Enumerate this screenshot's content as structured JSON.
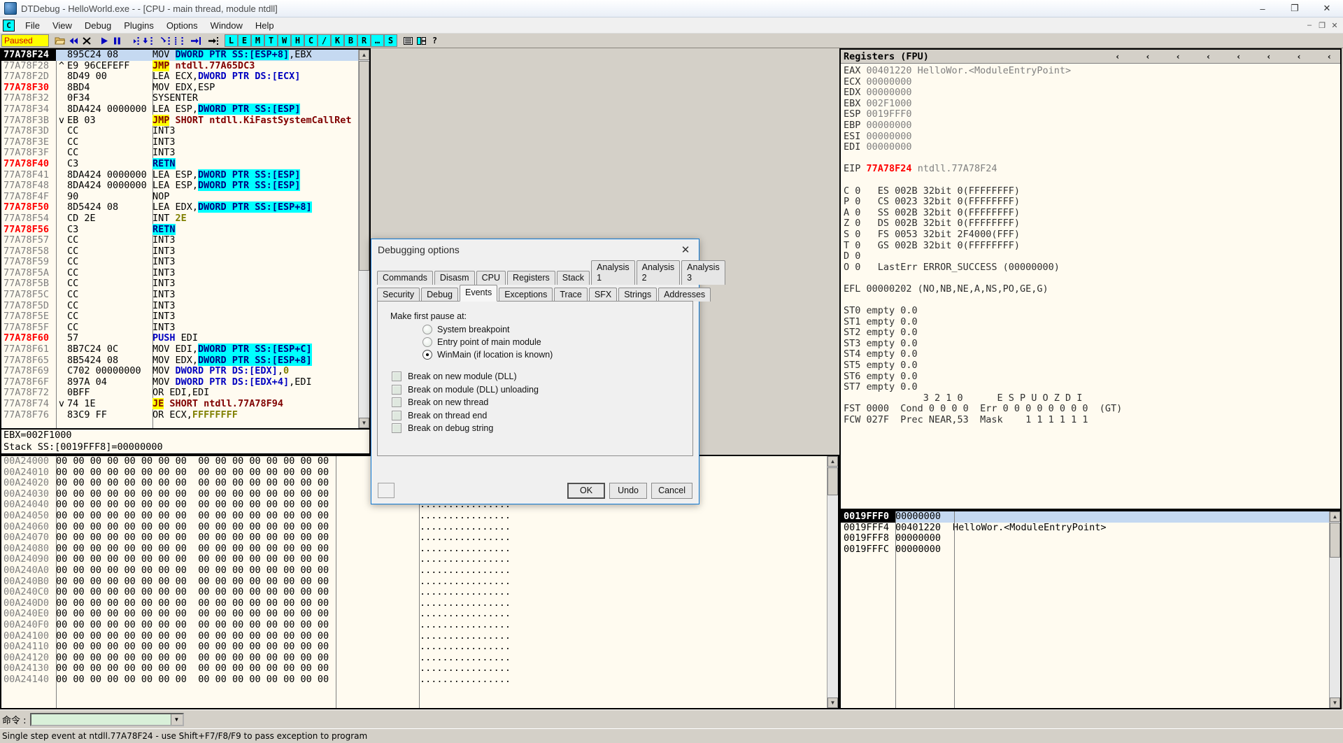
{
  "window": {
    "title": "DTDebug - HelloWorld.exe - - [CPU - main thread, module ntdll]",
    "app_icon": "debugger-icon",
    "minimize": "–",
    "maximize": "❐",
    "close": "✕"
  },
  "menu": {
    "mdi_icon_label": "C",
    "items": [
      "File",
      "View",
      "Debug",
      "Plugins",
      "Options",
      "Window",
      "Help"
    ],
    "sys_buttons": [
      "–",
      "❐",
      "✕"
    ]
  },
  "toolbar": {
    "status_label": "Paused",
    "buttons": [
      {
        "name": "open-file",
        "glyph": "icon-open"
      },
      {
        "name": "restart",
        "glyph": "icon-restart"
      },
      {
        "name": "close-program",
        "glyph": "icon-close-x"
      },
      {
        "name": "run",
        "glyph": "icon-run"
      },
      {
        "name": "pause",
        "glyph": "icon-pause"
      },
      {
        "name": "step-into",
        "glyph": "icon-step-into"
      },
      {
        "name": "step-over",
        "glyph": "icon-step-over"
      },
      {
        "name": "trace-into",
        "glyph": "icon-trace-into"
      },
      {
        "name": "trace-over",
        "glyph": "icon-trace-over"
      },
      {
        "name": "execute-till-return",
        "glyph": "icon-till-return"
      },
      {
        "name": "execute-till-cursor",
        "glyph": "icon-till-cursor"
      }
    ],
    "letters": [
      "L",
      "E",
      "M",
      "T",
      "W",
      "H",
      "C",
      "/",
      "K",
      "B",
      "R",
      "…",
      "S"
    ],
    "extra": [
      {
        "name": "options-window",
        "glyph": "icon-options"
      },
      {
        "name": "help",
        "glyph": "icon-help"
      },
      {
        "name": "question",
        "glyph": "?"
      }
    ]
  },
  "disassembly": {
    "panel_name": "CPU - main thread, module ntdll",
    "rows": [
      {
        "addr": "77A78F24",
        "hot": true,
        "selected": true,
        "arrow": "",
        "hex": "895C24 08",
        "parts": [
          {
            "t": "MOV ",
            "c": "plain"
          },
          {
            "t": "DWORD PTR SS:[ESP+8]",
            "c": "hl"
          },
          {
            "t": ",EBX",
            "c": "plain"
          }
        ]
      },
      {
        "addr": "77A78F28",
        "hot": false,
        "selected": false,
        "arrow": "^",
        "hex": "E9 96CEFEFF",
        "parts": [
          {
            "t": "JMP",
            "c": "jmp"
          },
          {
            "t": " ",
            "c": "plain"
          },
          {
            "t": "ntdll.77A65DC3",
            "c": "sym"
          }
        ]
      },
      {
        "addr": "77A78F2D",
        "hot": false,
        "selected": false,
        "arrow": "",
        "hex": "8D49 00",
        "parts": [
          {
            "t": "LEA ECX,",
            "c": "plain"
          },
          {
            "t": "DWORD PTR DS:[ECX]",
            "c": "kw"
          }
        ]
      },
      {
        "addr": "77A78F30",
        "hot": true,
        "selected": false,
        "arrow": "",
        "hex": "8BD4",
        "parts": [
          {
            "t": "MOV EDX,ESP",
            "c": "plain"
          }
        ]
      },
      {
        "addr": "77A78F32",
        "hot": false,
        "selected": false,
        "arrow": "",
        "hex": "0F34",
        "parts": [
          {
            "t": "SYSENTER",
            "c": "plain"
          }
        ]
      },
      {
        "addr": "77A78F34",
        "hot": false,
        "selected": false,
        "arrow": "",
        "hex": "8DA424 0000000",
        "parts": [
          {
            "t": "LEA ESP,",
            "c": "plain"
          },
          {
            "t": "DWORD PTR SS:[ESP]",
            "c": "hl"
          }
        ]
      },
      {
        "addr": "77A78F3B",
        "hot": false,
        "selected": false,
        "arrow": "v",
        "hex": "EB 03",
        "parts": [
          {
            "t": "JMP",
            "c": "jmp"
          },
          {
            "t": " ",
            "c": "plain"
          },
          {
            "t": "SHORT ntdll.KiFastSystemCallRet",
            "c": "sym"
          }
        ]
      },
      {
        "addr": "77A78F3D",
        "hot": false,
        "selected": false,
        "arrow": "",
        "hex": "CC",
        "parts": [
          {
            "t": "INT3",
            "c": "plain"
          }
        ]
      },
      {
        "addr": "77A78F3E",
        "hot": false,
        "selected": false,
        "arrow": "",
        "hex": "CC",
        "parts": [
          {
            "t": "INT3",
            "c": "plain"
          }
        ]
      },
      {
        "addr": "77A78F3F",
        "hot": false,
        "selected": false,
        "arrow": "",
        "hex": "CC",
        "parts": [
          {
            "t": "INT3",
            "c": "plain"
          }
        ]
      },
      {
        "addr": "77A78F40",
        "hot": true,
        "selected": false,
        "arrow": "",
        "hex": "C3",
        "parts": [
          {
            "t": "RETN",
            "c": "hl"
          }
        ]
      },
      {
        "addr": "77A78F41",
        "hot": false,
        "selected": false,
        "arrow": "",
        "hex": "8DA424 0000000",
        "parts": [
          {
            "t": "LEA ESP,",
            "c": "plain"
          },
          {
            "t": "DWORD PTR SS:[ESP]",
            "c": "hl"
          }
        ]
      },
      {
        "addr": "77A78F48",
        "hot": false,
        "selected": false,
        "arrow": "",
        "hex": "8DA424 0000000",
        "parts": [
          {
            "t": "LEA ESP,",
            "c": "plain"
          },
          {
            "t": "DWORD PTR SS:[ESP]",
            "c": "hl"
          }
        ]
      },
      {
        "addr": "77A78F4F",
        "hot": false,
        "selected": false,
        "arrow": "",
        "hex": "90",
        "parts": [
          {
            "t": "NOP",
            "c": "plain"
          }
        ]
      },
      {
        "addr": "77A78F50",
        "hot": true,
        "selected": false,
        "arrow": "",
        "hex": "8D5424 08",
        "parts": [
          {
            "t": "LEA EDX,",
            "c": "plain"
          },
          {
            "t": "DWORD PTR SS:[ESP+8]",
            "c": "hl"
          }
        ]
      },
      {
        "addr": "77A78F54",
        "hot": false,
        "selected": false,
        "arrow": "",
        "hex": "CD 2E",
        "parts": [
          {
            "t": "INT ",
            "c": "plain"
          },
          {
            "t": "2E",
            "c": "num"
          }
        ]
      },
      {
        "addr": "77A78F56",
        "hot": true,
        "selected": false,
        "arrow": "",
        "hex": "C3",
        "parts": [
          {
            "t": "RETN",
            "c": "hl"
          }
        ]
      },
      {
        "addr": "77A78F57",
        "hot": false,
        "selected": false,
        "arrow": "",
        "hex": "CC",
        "parts": [
          {
            "t": "INT3",
            "c": "plain"
          }
        ]
      },
      {
        "addr": "77A78F58",
        "hot": false,
        "selected": false,
        "arrow": "",
        "hex": "CC",
        "parts": [
          {
            "t": "INT3",
            "c": "plain"
          }
        ]
      },
      {
        "addr": "77A78F59",
        "hot": false,
        "selected": false,
        "arrow": "",
        "hex": "CC",
        "parts": [
          {
            "t": "INT3",
            "c": "plain"
          }
        ]
      },
      {
        "addr": "77A78F5A",
        "hot": false,
        "selected": false,
        "arrow": "",
        "hex": "CC",
        "parts": [
          {
            "t": "INT3",
            "c": "plain"
          }
        ]
      },
      {
        "addr": "77A78F5B",
        "hot": false,
        "selected": false,
        "arrow": "",
        "hex": "CC",
        "parts": [
          {
            "t": "INT3",
            "c": "plain"
          }
        ]
      },
      {
        "addr": "77A78F5C",
        "hot": false,
        "selected": false,
        "arrow": "",
        "hex": "CC",
        "parts": [
          {
            "t": "INT3",
            "c": "plain"
          }
        ]
      },
      {
        "addr": "77A78F5D",
        "hot": false,
        "selected": false,
        "arrow": "",
        "hex": "CC",
        "parts": [
          {
            "t": "INT3",
            "c": "plain"
          }
        ]
      },
      {
        "addr": "77A78F5E",
        "hot": false,
        "selected": false,
        "arrow": "",
        "hex": "CC",
        "parts": [
          {
            "t": "INT3",
            "c": "plain"
          }
        ]
      },
      {
        "addr": "77A78F5F",
        "hot": false,
        "selected": false,
        "arrow": "",
        "hex": "CC",
        "parts": [
          {
            "t": "INT3",
            "c": "plain"
          }
        ]
      },
      {
        "addr": "77A78F60",
        "hot": true,
        "selected": false,
        "arrow": "",
        "hex": "57",
        "parts": [
          {
            "t": "PUSH",
            "c": "kw"
          },
          {
            "t": " EDI",
            "c": "plain"
          }
        ]
      },
      {
        "addr": "77A78F61",
        "hot": false,
        "selected": false,
        "arrow": "",
        "hex": "8B7C24 0C",
        "parts": [
          {
            "t": "MOV EDI,",
            "c": "plain"
          },
          {
            "t": "DWORD PTR SS:[ESP+C]",
            "c": "hl"
          }
        ]
      },
      {
        "addr": "77A78F65",
        "hot": false,
        "selected": false,
        "arrow": "",
        "hex": "8B5424 08",
        "parts": [
          {
            "t": "MOV EDX,",
            "c": "plain"
          },
          {
            "t": "DWORD PTR SS:[ESP+8]",
            "c": "hl"
          }
        ]
      },
      {
        "addr": "77A78F69",
        "hot": false,
        "selected": false,
        "arrow": "",
        "hex": "C702 00000000",
        "parts": [
          {
            "t": "MOV ",
            "c": "plain"
          },
          {
            "t": "DWORD PTR DS:[EDX]",
            "c": "kw"
          },
          {
            "t": ",",
            "c": "plain"
          },
          {
            "t": "0",
            "c": "num"
          }
        ]
      },
      {
        "addr": "77A78F6F",
        "hot": false,
        "selected": false,
        "arrow": "",
        "hex": "897A 04",
        "parts": [
          {
            "t": "MOV ",
            "c": "plain"
          },
          {
            "t": "DWORD PTR DS:[EDX+4]",
            "c": "kw"
          },
          {
            "t": ",EDI",
            "c": "plain"
          }
        ]
      },
      {
        "addr": "77A78F72",
        "hot": false,
        "selected": false,
        "arrow": "",
        "hex": "0BFF",
        "parts": [
          {
            "t": "OR EDI,EDI",
            "c": "plain"
          }
        ]
      },
      {
        "addr": "77A78F74",
        "hot": false,
        "selected": false,
        "arrow": "v",
        "hex": "74 1E",
        "parts": [
          {
            "t": "JE",
            "c": "jmp"
          },
          {
            "t": " ",
            "c": "plain"
          },
          {
            "t": "SHORT ntdll.77A78F94",
            "c": "sym"
          }
        ]
      },
      {
        "addr": "77A78F76",
        "hot": false,
        "selected": false,
        "arrow": "",
        "hex": "83C9 FF",
        "parts": [
          {
            "t": "OR ECX,",
            "c": "plain"
          },
          {
            "t": "FFFFFFFF",
            "c": "num"
          }
        ]
      }
    ]
  },
  "infobar": {
    "line1": "EBX=002F1000",
    "line2": "Stack SS:[0019FFF8]=00000000"
  },
  "dump": {
    "rows": [
      {
        "addr": "00A24000",
        "hex": "00 00 00 00 00 00 00 00  00 00 00 00 00 00 00 00",
        "ascii": "................"
      },
      {
        "addr": "00A24010",
        "hex": "00 00 00 00 00 00 00 00  00 00 00 00 00 00 00 00",
        "ascii": "................"
      },
      {
        "addr": "00A24020",
        "hex": "00 00 00 00 00 00 00 00  00 00 00 00 00 00 00 00",
        "ascii": "................"
      },
      {
        "addr": "00A24030",
        "hex": "00 00 00 00 00 00 00 00  00 00 00 00 00 00 00 00",
        "ascii": "................"
      },
      {
        "addr": "00A24040",
        "hex": "00 00 00 00 00 00 00 00  00 00 00 00 00 00 00 00",
        "ascii": "................"
      },
      {
        "addr": "00A24050",
        "hex": "00 00 00 00 00 00 00 00  00 00 00 00 00 00 00 00",
        "ascii": "................"
      },
      {
        "addr": "00A24060",
        "hex": "00 00 00 00 00 00 00 00  00 00 00 00 00 00 00 00",
        "ascii": "................"
      },
      {
        "addr": "00A24070",
        "hex": "00 00 00 00 00 00 00 00  00 00 00 00 00 00 00 00",
        "ascii": "................"
      },
      {
        "addr": "00A24080",
        "hex": "00 00 00 00 00 00 00 00  00 00 00 00 00 00 00 00",
        "ascii": "................"
      },
      {
        "addr": "00A24090",
        "hex": "00 00 00 00 00 00 00 00  00 00 00 00 00 00 00 00",
        "ascii": "................"
      },
      {
        "addr": "00A240A0",
        "hex": "00 00 00 00 00 00 00 00  00 00 00 00 00 00 00 00",
        "ascii": "................"
      },
      {
        "addr": "00A240B0",
        "hex": "00 00 00 00 00 00 00 00  00 00 00 00 00 00 00 00",
        "ascii": "................"
      },
      {
        "addr": "00A240C0",
        "hex": "00 00 00 00 00 00 00 00  00 00 00 00 00 00 00 00",
        "ascii": "................"
      },
      {
        "addr": "00A240D0",
        "hex": "00 00 00 00 00 00 00 00  00 00 00 00 00 00 00 00",
        "ascii": "................"
      },
      {
        "addr": "00A240E0",
        "hex": "00 00 00 00 00 00 00 00  00 00 00 00 00 00 00 00",
        "ascii": "................"
      },
      {
        "addr": "00A240F0",
        "hex": "00 00 00 00 00 00 00 00  00 00 00 00 00 00 00 00",
        "ascii": "................"
      },
      {
        "addr": "00A24100",
        "hex": "00 00 00 00 00 00 00 00  00 00 00 00 00 00 00 00",
        "ascii": "................"
      },
      {
        "addr": "00A24110",
        "hex": "00 00 00 00 00 00 00 00  00 00 00 00 00 00 00 00",
        "ascii": "................"
      },
      {
        "addr": "00A24120",
        "hex": "00 00 00 00 00 00 00 00  00 00 00 00 00 00 00 00",
        "ascii": "................"
      },
      {
        "addr": "00A24130",
        "hex": "00 00 00 00 00 00 00 00  00 00 00 00 00 00 00 00",
        "ascii": "................"
      },
      {
        "addr": "00A24140",
        "hex": "00 00 00 00 00 00 00 00  00 00 00 00 00 00 00 00",
        "ascii": "................"
      }
    ]
  },
  "registers": {
    "title": "Registers (FPU)",
    "chevrons": [
      "‹",
      "‹",
      "‹",
      "‹",
      "‹",
      "‹",
      "‹",
      "‹"
    ],
    "general": [
      {
        "name": "EAX",
        "value": "00401220",
        "comment": "HelloWor.<ModuleEntryPoint>"
      },
      {
        "name": "ECX",
        "value": "00000000",
        "comment": ""
      },
      {
        "name": "EDX",
        "value": "00000000",
        "comment": ""
      },
      {
        "name": "EBX",
        "value": "002F1000",
        "comment": ""
      },
      {
        "name": "ESP",
        "value": "0019FFF0",
        "comment": ""
      },
      {
        "name": "EBP",
        "value": "00000000",
        "comment": ""
      },
      {
        "name": "ESI",
        "value": "00000000",
        "comment": ""
      },
      {
        "name": "EDI",
        "value": "00000000",
        "comment": ""
      }
    ],
    "eip": {
      "name": "EIP",
      "value": "77A78F24",
      "comment": "ntdll.77A78F24"
    },
    "flags_segments": [
      "C 0   ES 002B 32bit 0(FFFFFFFF)",
      "P 0   CS 0023 32bit 0(FFFFFFFF)",
      "A 0   SS 002B 32bit 0(FFFFFFFF)",
      "Z 0   DS 002B 32bit 0(FFFFFFFF)",
      "S 0   FS 0053 32bit 2F4000(FFF)",
      "T 0   GS 002B 32bit 0(FFFFFFFF)",
      "D 0",
      "O 0   LastErr ERROR_SUCCESS (00000000)"
    ],
    "efl": "EFL 00000202 (NO,NB,NE,A,NS,PO,GE,G)",
    "fpu": [
      "ST0 empty 0.0",
      "ST1 empty 0.0",
      "ST2 empty 0.0",
      "ST3 empty 0.0",
      "ST4 empty 0.0",
      "ST5 empty 0.0",
      "ST6 empty 0.0",
      "ST7 empty 0.0"
    ],
    "fpu_header": "              3 2 1 0      E S P U O Z D I",
    "fst": "FST 0000  Cond 0 0 0 0  Err 0 0 0 0 0 0 0 0  (GT)",
    "fcw": "FCW 027F  Prec NEAR,53  Mask    1 1 1 1 1 1"
  },
  "stack": {
    "rows": [
      {
        "addr": "0019FFF0",
        "value": "00000000",
        "comment": "",
        "selected": true
      },
      {
        "addr": "0019FFF4",
        "value": "00401220",
        "comment": "HelloWor.<ModuleEntryPoint>",
        "selected": false
      },
      {
        "addr": "0019FFF8",
        "value": "00000000",
        "comment": "",
        "selected": false
      },
      {
        "addr": "0019FFFC",
        "value": "00000000",
        "comment": "",
        "selected": false
      }
    ]
  },
  "dialog": {
    "title": "Debugging options",
    "close_glyph": "✕",
    "tabs_row1": [
      "Commands",
      "Disasm",
      "CPU",
      "Registers",
      "Stack",
      "Analysis 1",
      "Analysis 2",
      "Analysis 3"
    ],
    "tabs_row2": [
      "Security",
      "Debug",
      "Events",
      "Exceptions",
      "Trace",
      "SFX",
      "Strings",
      "Addresses"
    ],
    "active_tab": "Events",
    "group_label": "Make first pause at:",
    "radios": [
      {
        "label": "System breakpoint",
        "checked": false
      },
      {
        "label": "Entry point of main module",
        "checked": false
      },
      {
        "label": "WinMain (if location is known)",
        "checked": true
      }
    ],
    "checkboxes": [
      {
        "label": "Break on new module (DLL)",
        "checked": false
      },
      {
        "label": "Break on module (DLL) unloading",
        "checked": false
      },
      {
        "label": "Break on new thread",
        "checked": false
      },
      {
        "label": "Break on thread end",
        "checked": false
      },
      {
        "label": "Break on debug string",
        "checked": false
      }
    ],
    "buttons": [
      {
        "label": "OK",
        "default": true
      },
      {
        "label": "Undo",
        "default": false
      },
      {
        "label": "Cancel",
        "default": false
      }
    ]
  },
  "command_bar": {
    "label": "命令 :",
    "value": "",
    "placeholder": "",
    "dropdown_glyph": "▼"
  },
  "status_bar": {
    "text": "Single step event at ntdll.77A78F24 - use Shift+F7/F8/F9 to pass exception to program"
  },
  "colors": {
    "highlight_cyan": "#00ffff",
    "jump_yellow": "#ffff00",
    "hot_red": "#ff0000",
    "panel_bg": "#fffbf0",
    "chrome": "#d4d0c8",
    "selection": "#c5d9f1",
    "dialog_border": "#0f79d4"
  }
}
